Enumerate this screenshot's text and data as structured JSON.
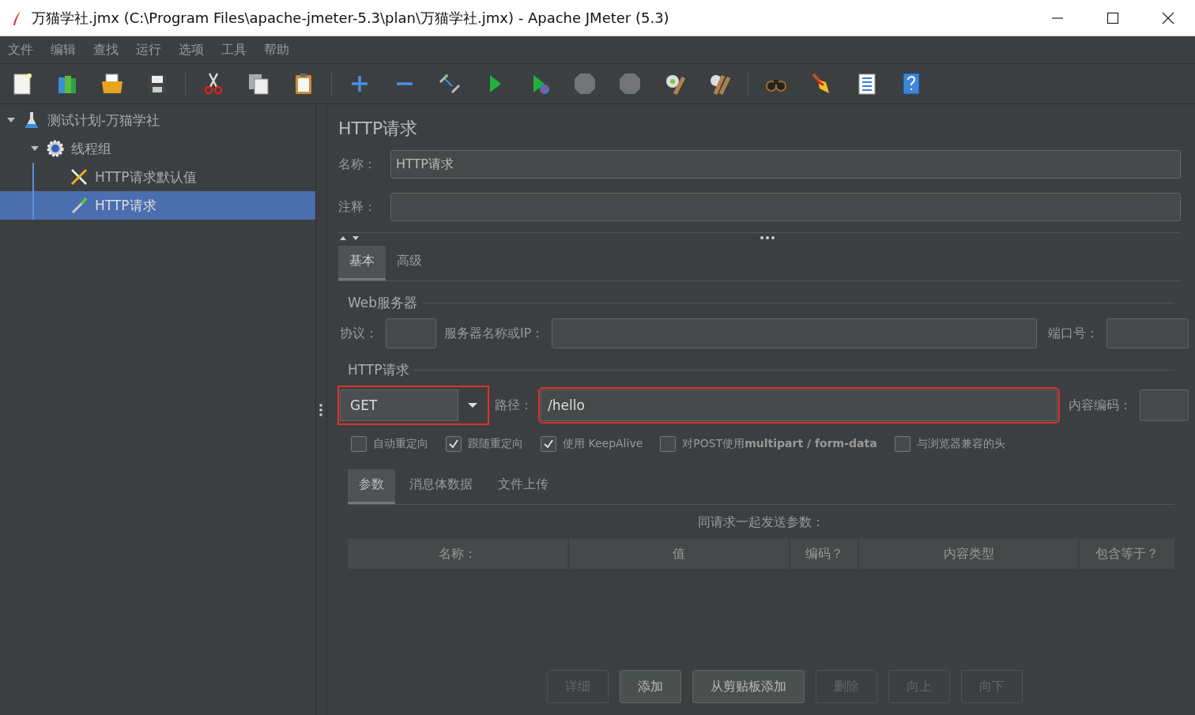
{
  "window": {
    "title": "万猫学社.jmx (C:\\Program Files\\apache-jmeter-5.3\\plan\\万猫学社.jmx) - Apache JMeter (5.3)"
  },
  "menu": [
    "文件",
    "编辑",
    "查找",
    "运行",
    "选项",
    "工具",
    "帮助"
  ],
  "toolbar": [
    {
      "disabled": false
    },
    {
      "disabled": false
    },
    {
      "disabled": false
    },
    {
      "disabled": false
    },
    {
      "disabled": false
    },
    {
      "disabled": false
    },
    {
      "disabled": false
    },
    {
      "disabled": false
    },
    {
      "disabled": false
    },
    {
      "disabled": false
    },
    {
      "disabled": false
    },
    {
      "disabled": false
    },
    {
      "disabled": true
    },
    {
      "disabled": true
    },
    {
      "disabled": false
    },
    {
      "disabled": false
    },
    {
      "disabled": false
    },
    {
      "disabled": false
    },
    {
      "disabled": false
    },
    {
      "disabled": false
    }
  ],
  "tree": [
    {
      "label": "测试计划-万猫学社",
      "kind": "plan",
      "expanded": true,
      "selected": false,
      "children": [
        {
          "label": "线程组",
          "kind": "threads",
          "expanded": true,
          "selected": false,
          "children": [
            {
              "label": "HTTP请求默认值",
              "kind": "defaults",
              "selected": false
            },
            {
              "label": "HTTP请求",
              "kind": "sampler",
              "selected": true
            }
          ]
        }
      ]
    }
  ],
  "panel": {
    "title": "HTTP请求",
    "name": {
      "label": "名称：",
      "value": "HTTP请求"
    },
    "comment": {
      "label": "注释："
    },
    "tabs": [
      {
        "label": "基本",
        "selected": true
      },
      {
        "label": "高级",
        "selected": false
      }
    ],
    "web_server": {
      "legend": "Web服务器",
      "protocol_label": "协议：",
      "server_label": "服务器名称或IP：",
      "port_label": "端口号："
    },
    "http_request": {
      "legend": "HTTP请求",
      "method": {
        "value": "GET",
        "highlighted": true
      },
      "path_label": "路径：",
      "path": {
        "value": "/hello",
        "highlighted": true
      },
      "encoding_label": "内容编码："
    },
    "options": [
      {
        "label": "自动重定向",
        "checked": false
      },
      {
        "label": "跟随重定向",
        "checked": true
      },
      {
        "label": "使用 KeepAlive",
        "checked": true
      },
      {
        "label": "对POST使用**multipart / form-data**",
        "checked": false
      },
      {
        "label": "与浏览器兼容的头",
        "checked": false
      }
    ],
    "sub_tabs": [
      {
        "label": "参数",
        "selected": true
      },
      {
        "label": "消息体数据",
        "selected": false
      },
      {
        "label": "文件上传",
        "selected": false
      }
    ],
    "table_caption": "同请求一起发送参数：",
    "columns": [
      "名称：",
      "值",
      "编码？",
      "内容类型",
      "包含等于？"
    ],
    "buttons": [
      {
        "label": "详细",
        "disabled": true
      },
      {
        "label": "添加",
        "disabled": false
      },
      {
        "label": "从剪贴板添加",
        "disabled": false
      },
      {
        "label": "删除",
        "disabled": true
      },
      {
        "label": "向上",
        "disabled": true
      },
      {
        "label": "向下",
        "disabled": true
      }
    ]
  }
}
